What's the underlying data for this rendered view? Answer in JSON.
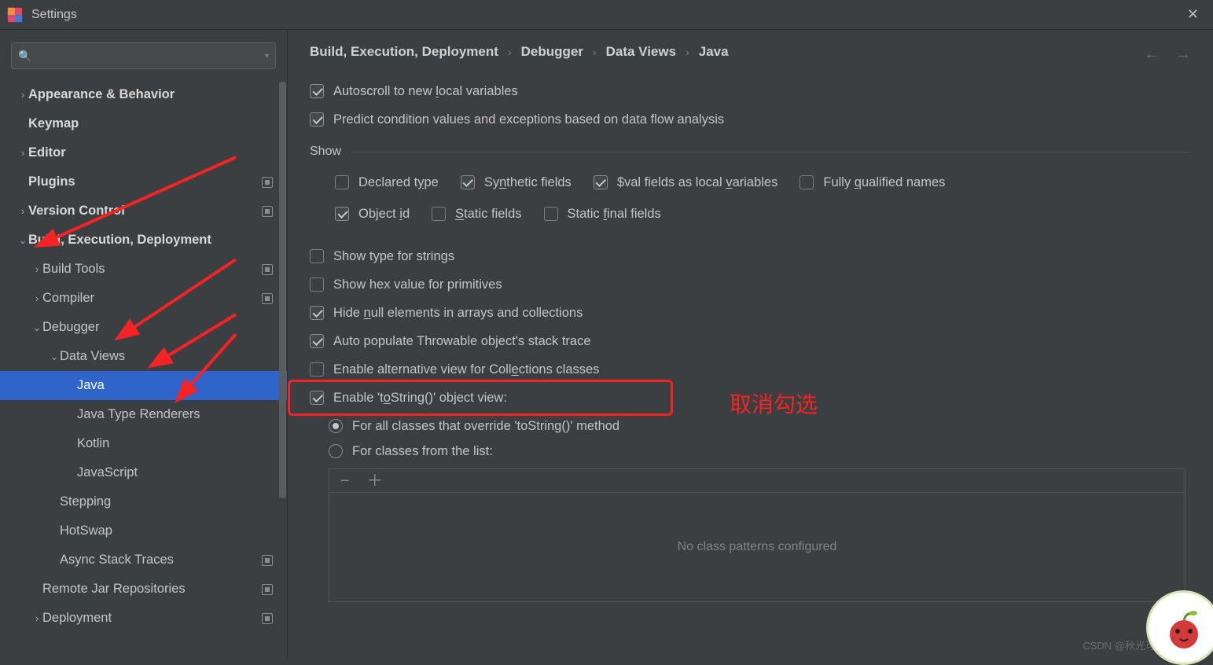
{
  "window": {
    "title": "Settings"
  },
  "search": {
    "placeholder": ""
  },
  "sidebar": {
    "items": [
      {
        "label": "Appearance & Behavior",
        "depth": 1,
        "bold": true,
        "arrow": ">",
        "badge": false
      },
      {
        "label": "Keymap",
        "depth": 1,
        "bold": true,
        "arrow": "",
        "badge": false
      },
      {
        "label": "Editor",
        "depth": 1,
        "bold": true,
        "arrow": ">",
        "badge": false
      },
      {
        "label": "Plugins",
        "depth": 1,
        "bold": true,
        "arrow": "",
        "badge": true
      },
      {
        "label": "Version Control",
        "depth": 1,
        "bold": true,
        "arrow": ">",
        "badge": true
      },
      {
        "label": "Build, Execution, Deployment",
        "depth": 1,
        "bold": true,
        "arrow": "v",
        "badge": false
      },
      {
        "label": "Build Tools",
        "depth": 2,
        "bold": false,
        "arrow": ">",
        "badge": true
      },
      {
        "label": "Compiler",
        "depth": 2,
        "bold": false,
        "arrow": ">",
        "badge": true
      },
      {
        "label": "Debugger",
        "depth": 2,
        "bold": false,
        "arrow": "v",
        "badge": false
      },
      {
        "label": "Data Views",
        "depth": 3,
        "bold": false,
        "arrow": "v",
        "badge": false
      },
      {
        "label": "Java",
        "depth": 4,
        "bold": false,
        "arrow": "",
        "badge": false,
        "selected": true
      },
      {
        "label": "Java Type Renderers",
        "depth": 4,
        "bold": false,
        "arrow": "",
        "badge": false
      },
      {
        "label": "Kotlin",
        "depth": 4,
        "bold": false,
        "arrow": "",
        "badge": false
      },
      {
        "label": "JavaScript",
        "depth": 4,
        "bold": false,
        "arrow": "",
        "badge": false
      },
      {
        "label": "Stepping",
        "depth": 3,
        "bold": false,
        "arrow": "",
        "badge": false
      },
      {
        "label": "HotSwap",
        "depth": 3,
        "bold": false,
        "arrow": "",
        "badge": false
      },
      {
        "label": "Async Stack Traces",
        "depth": 3,
        "bold": false,
        "arrow": "",
        "badge": true
      },
      {
        "label": "Remote Jar Repositories",
        "depth": 2,
        "bold": false,
        "arrow": "",
        "badge": true
      },
      {
        "label": "Deployment",
        "depth": 2,
        "bold": false,
        "arrow": ">",
        "badge": true
      }
    ]
  },
  "breadcrumbs": [
    "Build, Execution, Deployment",
    "Debugger",
    "Data Views",
    "Java"
  ],
  "opts": {
    "top": [
      {
        "key": "autoscroll",
        "checked": true,
        "pre": "Autoscroll to new ",
        "ul": "l",
        "post": "ocal variables"
      },
      {
        "key": "predict",
        "checked": true,
        "pre": "Predict condition values and exceptions based on data flow analysis",
        "ul": "",
        "post": ""
      }
    ],
    "show_label": "Show",
    "show": [
      {
        "key": "declared",
        "checked": false,
        "pre": "Declared t",
        "ul": "y",
        "post": "pe"
      },
      {
        "key": "synthetic",
        "checked": true,
        "pre": "Sy",
        "ul": "n",
        "post": "thetic fields"
      },
      {
        "key": "valfields",
        "checked": true,
        "pre": "$val fields as local ",
        "ul": "v",
        "post": "ariables"
      },
      {
        "key": "fqnames",
        "checked": false,
        "pre": "Fully ",
        "ul": "q",
        "post": "ualified names"
      },
      {
        "key": "objid",
        "checked": true,
        "pre": "Object ",
        "ul": "i",
        "post": "d"
      },
      {
        "key": "staticf",
        "checked": false,
        "pre": "",
        "ul": "S",
        "post": "tatic fields"
      },
      {
        "key": "staticff",
        "checked": false,
        "pre": "Static ",
        "ul": "f",
        "post": "inal fields"
      }
    ],
    "mid": [
      {
        "key": "typestr",
        "checked": false,
        "pre": "Show type for strings",
        "ul": "",
        "post": ""
      },
      {
        "key": "hexprim",
        "checked": false,
        "pre": "Show hex value for primitives",
        "ul": "",
        "post": ""
      },
      {
        "key": "hidenull",
        "checked": true,
        "pre": "Hide ",
        "ul": "n",
        "post": "ull elements in arrays and collections"
      },
      {
        "key": "autopopu",
        "checked": true,
        "pre": "Auto populate Throwable object's stack trace",
        "ul": "",
        "post": ""
      },
      {
        "key": "enablealt",
        "checked": false,
        "pre": "Enable alternative view for Coll",
        "ul": "e",
        "post": "ctions classes"
      },
      {
        "key": "enabletostr",
        "checked": true,
        "pre": "Enable 't",
        "ul": "o",
        "post": "String()' object view:"
      }
    ],
    "radios": [
      {
        "key": "r_all",
        "on": true,
        "label": "For all classes that override 'toString()' method"
      },
      {
        "key": "r_list",
        "on": false,
        "label": "For classes from the list:"
      }
    ],
    "list_empty": "No class patterns configured"
  },
  "annotations": {
    "red_text": "取消勾选",
    "watermark": "CSDN @秋光可可"
  }
}
